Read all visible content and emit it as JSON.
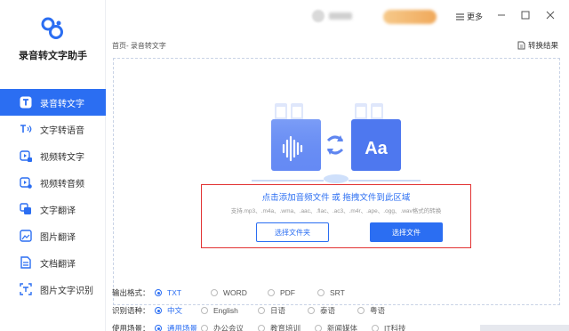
{
  "app": {
    "name": "录音转文字助手"
  },
  "sidebar": {
    "items": [
      {
        "label": "录音转文字",
        "icon": "text-t-icon",
        "active": true
      },
      {
        "label": "文字转语音",
        "icon": "text-to-speech-icon"
      },
      {
        "label": "视频转文字",
        "icon": "video-to-text-icon"
      },
      {
        "label": "视频转音频",
        "icon": "video-to-audio-icon"
      },
      {
        "label": "文字翻译",
        "icon": "translate-icon"
      },
      {
        "label": "图片翻译",
        "icon": "image-translate-icon"
      },
      {
        "label": "文档翻译",
        "icon": "document-translate-icon"
      },
      {
        "label": "图片文字识别",
        "icon": "ocr-icon"
      }
    ]
  },
  "topbar": {
    "more_label": "更多"
  },
  "content": {
    "breadcrumb": "首页- 录音转文字",
    "convert_result": "转换结果",
    "dropzone": {
      "hint_main": "点击添加音频文件 或 拖拽文件到此区域",
      "hint_sub": "支持.mp3、.m4a、.wma、.aac、.flac、.ac3、.m4r、.ape、.ogg、.wav格式的转换",
      "btn_folder": "选择文件夹",
      "btn_file": "选择文件"
    },
    "options": {
      "output_format": {
        "label": "输出格式：",
        "choices": [
          "TXT",
          "WORD",
          "PDF",
          "SRT"
        ],
        "selected": "TXT"
      },
      "language": {
        "label": "识别语种：",
        "choices": [
          "中文",
          "English",
          "日语",
          "泰语",
          "粤语"
        ],
        "selected": "中文"
      },
      "scene": {
        "label": "使用场景：",
        "choices": [
          "通用场景",
          "办公会议",
          "教育培训",
          "新闻媒体",
          "IT科技"
        ],
        "selected": "通用场景"
      }
    }
  },
  "colors": {
    "accent": "#2b6ef2",
    "highlight_border": "#e23232"
  }
}
